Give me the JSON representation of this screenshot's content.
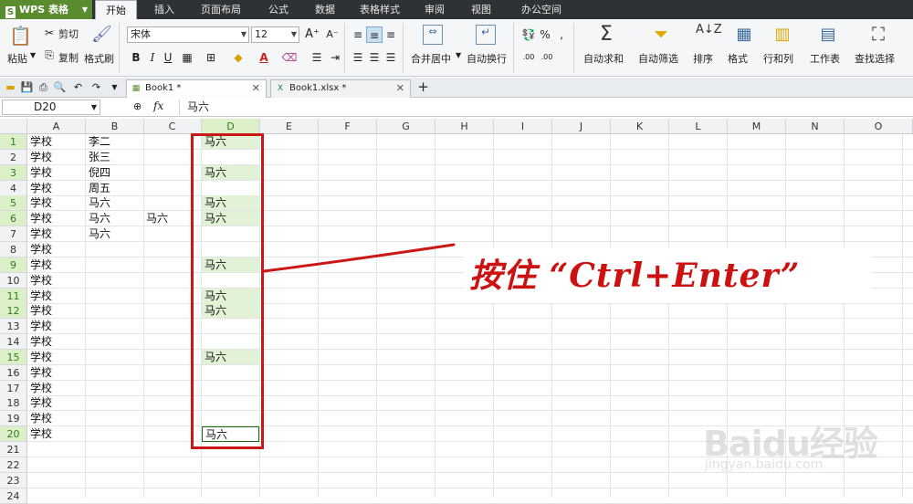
{
  "app": {
    "name": "WPS 表格",
    "logo": "S"
  },
  "menu": [
    "开始",
    "插入",
    "页面布局",
    "公式",
    "数据",
    "表格样式",
    "审阅",
    "视图",
    "办公空间"
  ],
  "menu_active": "开始",
  "ribbon": {
    "paste": "粘贴",
    "cut": "剪切",
    "copy": "复制",
    "format_painter": "格式刷",
    "font_name": "宋体",
    "font_size": "12",
    "merge_center": "合并居中",
    "wrap_text": "自动换行",
    "autosum": "自动求和",
    "autofilter": "自动筛选",
    "sort": "排序",
    "format": "格式",
    "rows_cols": "行和列",
    "worksheet": "工作表",
    "find_select": "查找选择",
    "percent": "%",
    "comma": ",",
    "dec_inc": ".00",
    "dec_dec": ".00"
  },
  "doc_tabs": [
    {
      "name": "Book1 *"
    },
    {
      "name": "Book1.xlsx *"
    }
  ],
  "formula_bar": {
    "cell_ref": "D20",
    "fx": "fx",
    "value": "马六"
  },
  "columns": [
    "A",
    "B",
    "C",
    "D",
    "E",
    "F",
    "G",
    "H",
    "I",
    "J",
    "K",
    "L",
    "M",
    "N",
    "O"
  ],
  "selected_column": "D",
  "rows": [
    {
      "n": "1",
      "A": "学校",
      "B": "李二",
      "C": "",
      "D": "马六"
    },
    {
      "n": "2",
      "A": "学校",
      "B": "张三",
      "C": "",
      "D": ""
    },
    {
      "n": "3",
      "A": "学校",
      "B": "倪四",
      "C": "",
      "D": "马六"
    },
    {
      "n": "4",
      "A": "学校",
      "B": "周五",
      "C": "",
      "D": ""
    },
    {
      "n": "5",
      "A": "学校",
      "B": "马六",
      "C": "",
      "D": "马六"
    },
    {
      "n": "6",
      "A": "学校",
      "B": "马六",
      "C": "马六",
      "D": "马六"
    },
    {
      "n": "7",
      "A": "学校",
      "B": "马六",
      "C": "",
      "D": ""
    },
    {
      "n": "8",
      "A": "学校",
      "B": "",
      "C": "",
      "D": ""
    },
    {
      "n": "9",
      "A": "学校",
      "B": "",
      "C": "",
      "D": "马六"
    },
    {
      "n": "10",
      "A": "学校",
      "B": "",
      "C": "",
      "D": ""
    },
    {
      "n": "11",
      "A": "学校",
      "B": "",
      "C": "",
      "D": "马六"
    },
    {
      "n": "12",
      "A": "学校",
      "B": "",
      "C": "",
      "D": "马六"
    },
    {
      "n": "13",
      "A": "学校",
      "B": "",
      "C": "",
      "D": ""
    },
    {
      "n": "14",
      "A": "学校",
      "B": "",
      "C": "",
      "D": ""
    },
    {
      "n": "15",
      "A": "学校",
      "B": "",
      "C": "",
      "D": "马六"
    },
    {
      "n": "16",
      "A": "学校",
      "B": "",
      "C": "",
      "D": ""
    },
    {
      "n": "17",
      "A": "学校",
      "B": "",
      "C": "",
      "D": ""
    },
    {
      "n": "18",
      "A": "学校",
      "B": "",
      "C": "",
      "D": ""
    },
    {
      "n": "19",
      "A": "学校",
      "B": "",
      "C": "",
      "D": ""
    },
    {
      "n": "20",
      "A": "学校",
      "B": "",
      "C": "",
      "D": "马六"
    },
    {
      "n": "21",
      "A": "",
      "B": "",
      "C": "",
      "D": ""
    },
    {
      "n": "22",
      "A": "",
      "B": "",
      "C": "",
      "D": ""
    },
    {
      "n": "23",
      "A": "",
      "B": "",
      "C": "",
      "D": ""
    },
    {
      "n": "24",
      "A": "",
      "B": "",
      "C": "",
      "D": ""
    }
  ],
  "selected_rows": [
    "1",
    "3",
    "5",
    "6",
    "9",
    "11",
    "12",
    "15",
    "20"
  ],
  "annotation": {
    "text": "按住 “Ctrl+Enter”",
    "color": "#cc1111"
  },
  "watermark": {
    "logo": "Baidu经验",
    "url": "jingyan.baidu.com"
  },
  "accent_colors": {
    "title_bar": "#2f3235",
    "app_button": "#5a8b2d",
    "selection": "#e2f2d6",
    "annotation": "#cc1717"
  }
}
